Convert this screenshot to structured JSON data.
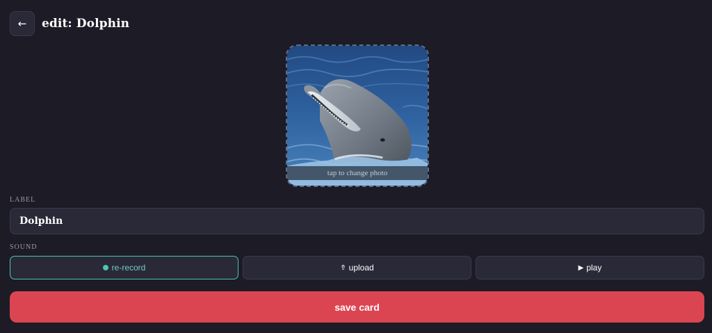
{
  "header": {
    "back_icon": "arrow-left-icon",
    "back_glyph": "←",
    "title": "edit: Dolphin"
  },
  "photo": {
    "subject": "dolphin",
    "caption": "tap to change photo"
  },
  "label_field": {
    "heading": "LABEL",
    "value": "Dolphin"
  },
  "sound": {
    "heading": "SOUND",
    "buttons": [
      {
        "label": "re-record",
        "icon": "record-dot-icon",
        "active": true
      },
      {
        "label": "upload",
        "icon": "upload-icon",
        "glyph": "⇮",
        "active": false
      },
      {
        "label": "play",
        "icon": "play-icon",
        "glyph": "▶",
        "active": false
      }
    ]
  },
  "save_label": "save card",
  "colors": {
    "background": "#1c1b26",
    "surface": "#2a2938",
    "accent": "#4fc3b4",
    "primary": "#db4551"
  }
}
